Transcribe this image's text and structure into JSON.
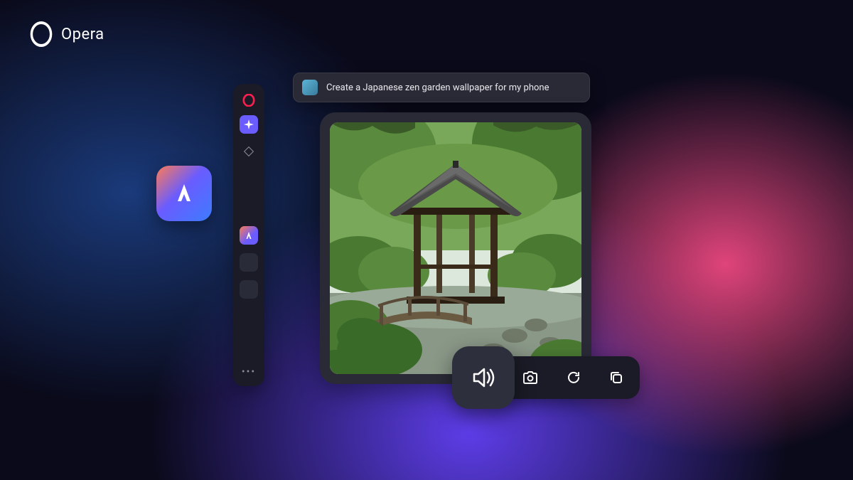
{
  "brand": {
    "name": "Opera"
  },
  "prompt": {
    "text": "Create a Japanese zen garden  wallpaper for my phone"
  },
  "sidebar": {
    "items": [
      {
        "name": "opera-logo"
      },
      {
        "name": "sparkle-active"
      },
      {
        "name": "diamond-nav"
      },
      {
        "name": "aria-app"
      },
      {
        "name": "placeholder-1"
      },
      {
        "name": "placeholder-2"
      },
      {
        "name": "more"
      }
    ]
  },
  "icons": {
    "aria": "aria-app-icon",
    "speaker": "speaker-icon",
    "camera": "camera-icon",
    "refresh": "refresh-icon",
    "copy": "copy-icon"
  },
  "image": {
    "description": "Japanese zen garden with wooden pagoda pavilion, curved bridge, moss-covered rocks, stepping stones and green foliage"
  }
}
